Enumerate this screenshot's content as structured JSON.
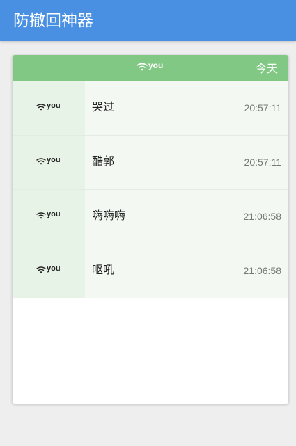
{
  "app_bar": {
    "title": "防撤回神器",
    "color": "#4a90e2"
  },
  "card": {
    "header": {
      "sender_icon": "wifi-icon",
      "sender_label": "you",
      "date_label": "今天",
      "color": "#82c885"
    },
    "messages": [
      {
        "icon": "wifi-icon",
        "sender": "you",
        "text": "哭过",
        "time": "20:57:11"
      },
      {
        "icon": "wifi-icon",
        "sender": "you",
        "text": "酷郭",
        "time": "20:57:11"
      },
      {
        "icon": "wifi-icon",
        "sender": "you",
        "text": "嗨嗨嗨",
        "time": "21:06:58"
      },
      {
        "icon": "wifi-icon",
        "sender": "you",
        "text": "呕吼",
        "time": "21:06:58"
      }
    ]
  }
}
